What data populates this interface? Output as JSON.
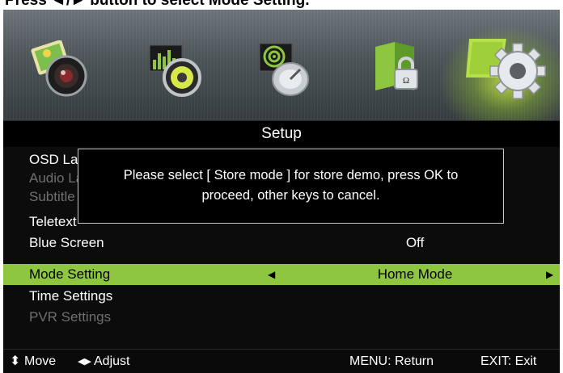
{
  "caption": "Press ◄/► button to select Mode Setting.",
  "icons": [
    {
      "name": "picture-icon"
    },
    {
      "name": "sound-icon"
    },
    {
      "name": "channel-icon"
    },
    {
      "name": "lock-icon"
    },
    {
      "name": "setup-icon",
      "selected": true
    }
  ],
  "menu": {
    "title": "Setup",
    "items": [
      {
        "label": "OSD Language",
        "value": "",
        "state": "normal"
      },
      {
        "label": "Audio Languages",
        "value": "",
        "state": "dim"
      },
      {
        "label": "Subtitle",
        "value": "",
        "state": "dim"
      },
      {
        "label": "Teletext",
        "value": "",
        "state": "normal"
      },
      {
        "label": "Blue Screen",
        "value": "Off",
        "state": "normal"
      },
      {
        "label": "Mode Setting",
        "value": "Home Mode",
        "state": "selected"
      },
      {
        "label": "Time Settings",
        "value": "",
        "state": "normal"
      },
      {
        "label": "PVR Settings",
        "value": "",
        "state": "dim"
      }
    ]
  },
  "dialog": {
    "line1": "Please select [ Store mode ] for store demo, press OK to",
    "line2": "proceed, other keys to cancel."
  },
  "footer": {
    "move": "Move",
    "adjust": "Adjust",
    "menu": "MENU: Return",
    "exit": "EXIT: Exit"
  },
  "colors": {
    "highlight": "#8ec63f",
    "background": "#0c0c0c",
    "dim_text": "#6f6f6f"
  }
}
